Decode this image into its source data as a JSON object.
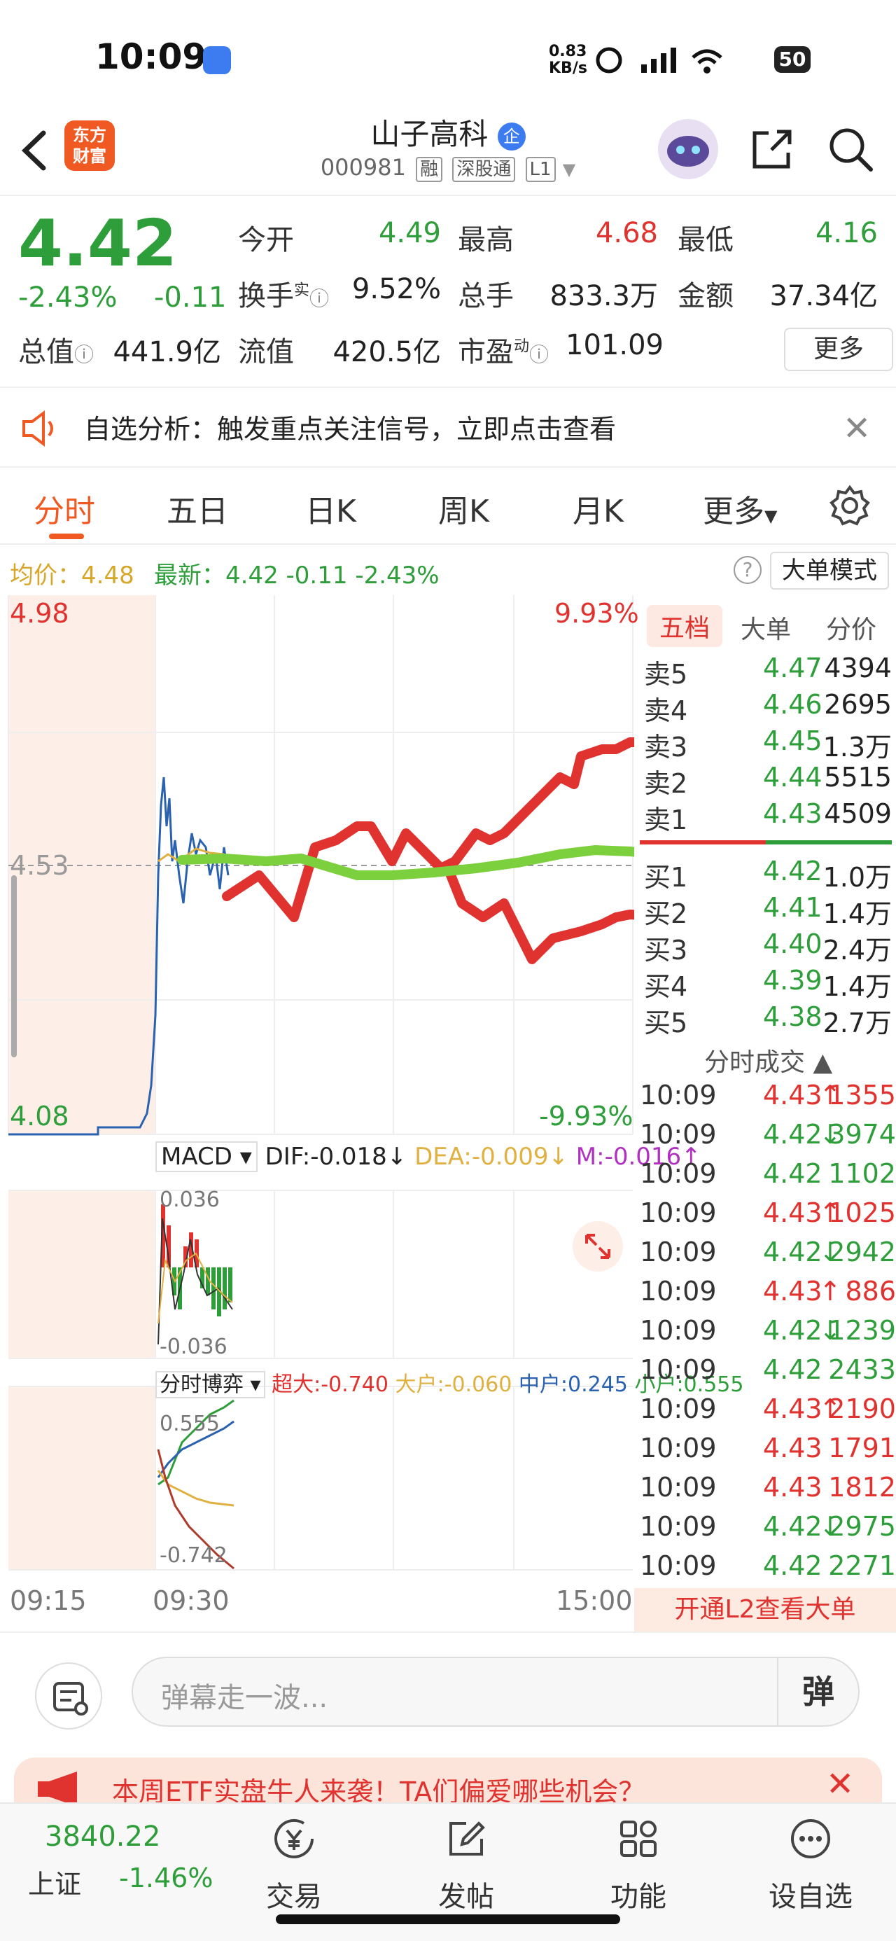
{
  "status_bar": {
    "time": "10:09",
    "net_speed_value": "0.83",
    "net_speed_unit": "KB/s",
    "battery": "50"
  },
  "header": {
    "logo_line1": "东方",
    "logo_line2": "财富",
    "stock_name": "山子高科",
    "badge": "企",
    "stock_code": "000981",
    "tags": [
      "融",
      "深股通",
      "L1"
    ]
  },
  "quote": {
    "price": "4.42",
    "change_pct": "-2.43%",
    "change": "-0.11",
    "fields": [
      {
        "label": "今开",
        "value": "4.49",
        "color": "green"
      },
      {
        "label": "最高",
        "value": "4.68",
        "color": "red"
      },
      {
        "label": "最低",
        "value": "4.16",
        "color": "green"
      },
      {
        "label": "换手",
        "value": "9.52%",
        "color": "dark"
      },
      {
        "label": "总手",
        "value": "833.3万",
        "color": "dark"
      },
      {
        "label": "金额",
        "value": "37.34亿",
        "color": "dark"
      },
      {
        "label": "总值",
        "value": "441.9亿",
        "color": "dark"
      },
      {
        "label": "流值",
        "value": "420.5亿",
        "color": "dark"
      },
      {
        "label": "市盈",
        "value": "101.09",
        "color": "dark"
      }
    ],
    "turnover_sup": "实",
    "pe_sup": "动",
    "more_label": "更多"
  },
  "notice": {
    "text": "自选分析：触发重点关注信号，立即点击查看"
  },
  "tabs": [
    "分时",
    "五日",
    "日K",
    "周K",
    "月K",
    "更多"
  ],
  "info_line": {
    "avg_label": "均价：",
    "avg_value": "4.48",
    "latest_label": "最新：",
    "latest_value": "4.42",
    "latest_change": "-0.11",
    "latest_pct": "-2.43%",
    "big_mode": "大单模式"
  },
  "chart_labels": {
    "top_price": "4.98",
    "mid_price": "4.53",
    "bottom_price": "4.08",
    "top_pct": "9.93%",
    "bottom_pct": "-9.93%",
    "macd_title": "MACD",
    "dif": "DIF:-0.018↓",
    "dea": "DEA:-0.009↓",
    "m": "M:-0.016↑",
    "macd_top": "0.036",
    "macd_bottom": "-0.036",
    "game_title": "分时博弈",
    "super": "超大:-0.740",
    "big": "大户:-0.060",
    "mid": "中户:0.245",
    "small": "小户:0.555",
    "game_top": "0.555",
    "game_bottom": "-0.742",
    "time_start": "09:15",
    "time_open": "09:30",
    "time_close": "15:00"
  },
  "order_book": {
    "tabs": [
      "五档",
      "大单",
      "分价"
    ],
    "asks": [
      {
        "label": "卖5",
        "price": "4.47",
        "vol": "4394"
      },
      {
        "label": "卖4",
        "price": "4.46",
        "vol": "2695"
      },
      {
        "label": "卖3",
        "price": "4.45",
        "vol": "1.3万"
      },
      {
        "label": "卖2",
        "price": "4.44",
        "vol": "5515"
      },
      {
        "label": "卖1",
        "price": "4.43",
        "vol": "4509"
      }
    ],
    "bids": [
      {
        "label": "买1",
        "price": "4.42",
        "vol": "1.0万"
      },
      {
        "label": "买2",
        "price": "4.41",
        "vol": "1.4万"
      },
      {
        "label": "买3",
        "price": "4.40",
        "vol": "2.4万"
      },
      {
        "label": "买4",
        "price": "4.39",
        "vol": "1.4万"
      },
      {
        "label": "买5",
        "price": "4.38",
        "vol": "2.7万"
      }
    ]
  },
  "trades": {
    "title": "分时成交",
    "rows": [
      {
        "time": "10:09",
        "price": "4.43",
        "dir": "↑",
        "vol": "1355",
        "c": "red"
      },
      {
        "time": "10:09",
        "price": "4.42",
        "dir": "↓",
        "vol": "3974",
        "c": "green"
      },
      {
        "time": "10:09",
        "price": "4.42",
        "dir": "",
        "vol": "1102",
        "c": "green"
      },
      {
        "time": "10:09",
        "price": "4.43",
        "dir": "↑",
        "vol": "1025",
        "c": "red"
      },
      {
        "time": "10:09",
        "price": "4.42",
        "dir": "↓",
        "vol": "2942",
        "c": "green"
      },
      {
        "time": "10:09",
        "price": "4.43",
        "dir": "↑",
        "vol": "886",
        "c": "red"
      },
      {
        "time": "10:09",
        "price": "4.42",
        "dir": "↓",
        "vol": "1239",
        "c": "green"
      },
      {
        "time": "10:09",
        "price": "4.42",
        "dir": "",
        "vol": "2433",
        "c": "green"
      },
      {
        "time": "10:09",
        "price": "4.43",
        "dir": "↑",
        "vol": "2190",
        "c": "red"
      },
      {
        "time": "10:09",
        "price": "4.43",
        "dir": "",
        "vol": "1791",
        "c": "red"
      },
      {
        "time": "10:09",
        "price": "4.43",
        "dir": "",
        "vol": "1812",
        "c": "red"
      },
      {
        "time": "10:09",
        "price": "4.42",
        "dir": "↓",
        "vol": "2975",
        "c": "green"
      },
      {
        "time": "10:09",
        "price": "4.42",
        "dir": "",
        "vol": "2271",
        "c": "green"
      }
    ],
    "l2_banner": "开通L2查看大单"
  },
  "danmu": {
    "placeholder": "弹幕走一波...",
    "send": "弹"
  },
  "promo": {
    "text": "本周ETF实盘牛人来袭！TA们偏爱哪些机会？"
  },
  "bottom_nav": {
    "index_value": "3840.22",
    "index_name": "上证",
    "index_change": "-1.46%",
    "items": [
      "交易",
      "发帖",
      "功能",
      "设自选"
    ]
  }
}
